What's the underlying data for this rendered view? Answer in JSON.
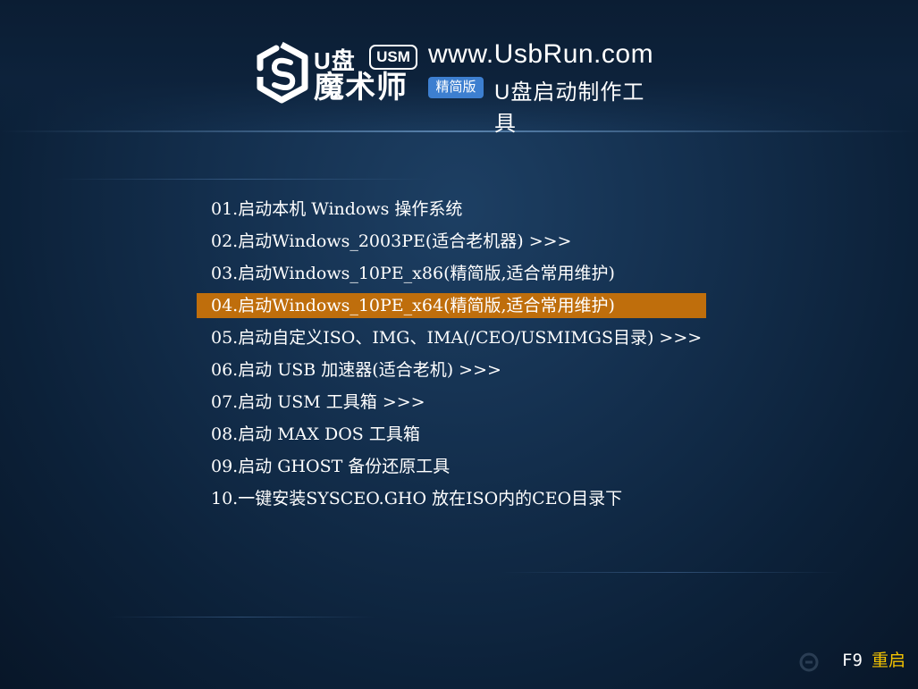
{
  "header": {
    "brand_u": "U盘",
    "brand_usm": "USM",
    "brand_name": "魔术师",
    "site_url": "www.UsbRun.com",
    "edition_badge": "精简版",
    "subtitle": "U盘启动制作工具"
  },
  "menu": {
    "selected_index": 3,
    "items": [
      "01.启动本机 Windows 操作系统",
      "02.启动Windows_2003PE(适合老机器) >>>",
      "03.启动Windows_10PE_x86(精简版,适合常用维护)",
      "04.启动Windows_10PE_x64(精简版,适合常用维护)",
      "05.启动自定义ISO、IMG、IMA(/CEO/USMIMGS目录) >>>",
      "06.启动 USB 加速器(适合老机) >>>",
      "07.启动 USM 工具箱 >>>",
      "08.启动 MAX DOS 工具箱",
      "09.启动 GHOST 备份还原工具",
      "10.一键安装SYSCEO.GHO 放在ISO内的CEO目录下"
    ]
  },
  "footer": {
    "key": "F9",
    "action": "重启"
  },
  "colors": {
    "selected_bg": "#bf6e0c",
    "reboot_text": "#f5c400",
    "badge_bg": "#3d7fd0"
  }
}
